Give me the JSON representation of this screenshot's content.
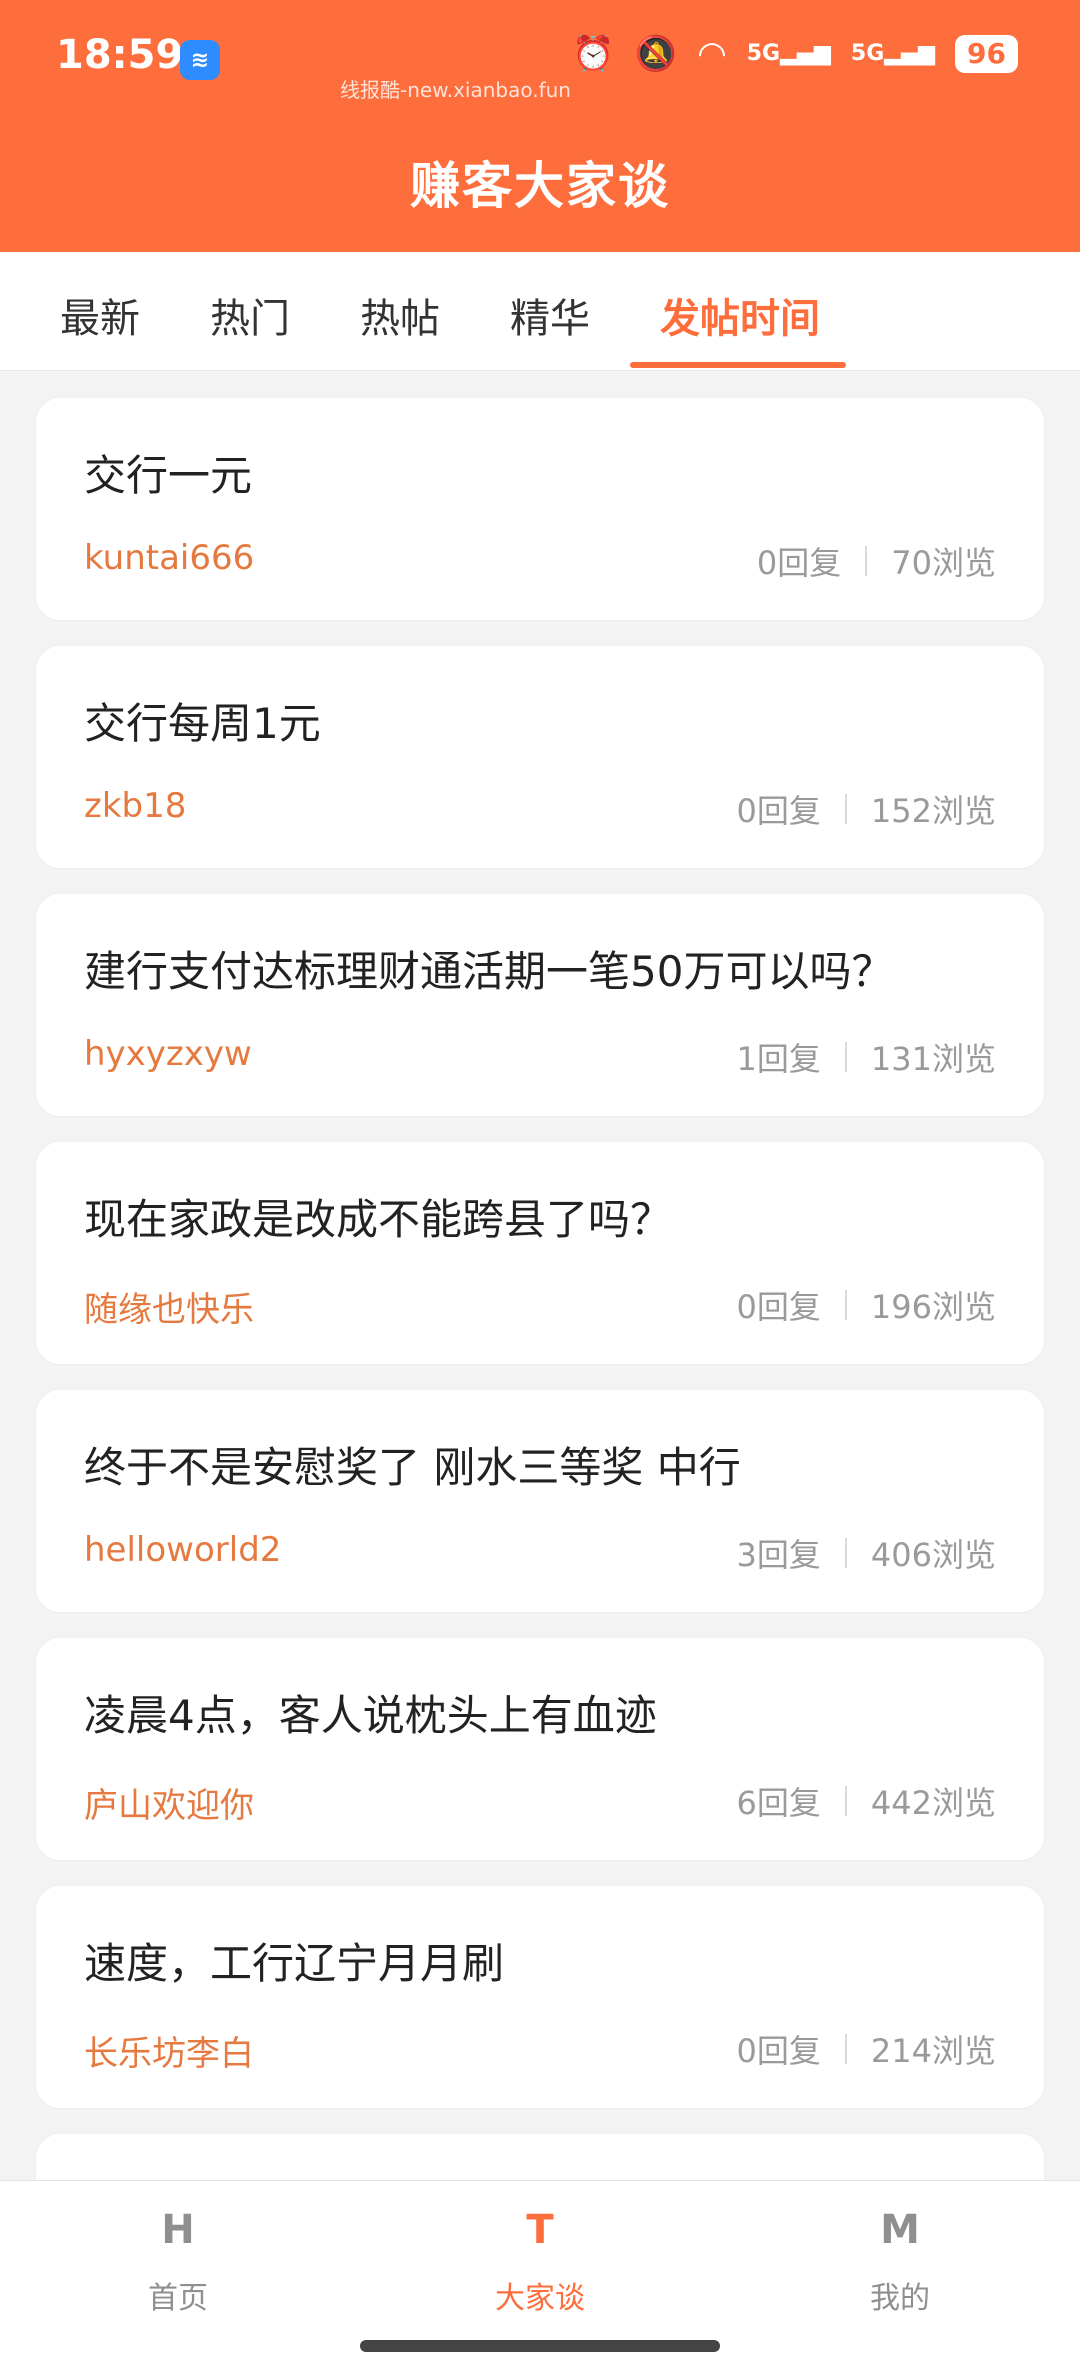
{
  "status": {
    "time": "18:59",
    "watermark": "线报酷-new.xianbao.fun",
    "signal1": "5G",
    "signal2": "5G",
    "battery": "96"
  },
  "header": {
    "title": "赚客大家谈"
  },
  "tabs": [
    {
      "label": "最新"
    },
    {
      "label": "热门"
    },
    {
      "label": "热帖"
    },
    {
      "label": "精华"
    },
    {
      "label": "发帖时间"
    }
  ],
  "posts": [
    {
      "title": "交行一元",
      "author": "kuntai666",
      "replies": "0回复",
      "views": "70浏览"
    },
    {
      "title": "交行每周1元",
      "author": "zkb18",
      "replies": "0回复",
      "views": "152浏览"
    },
    {
      "title": "建行支付达标理财通活期一笔50万可以吗？",
      "author": "hyxyzxyw",
      "replies": "1回复",
      "views": "131浏览"
    },
    {
      "title": "现在家政是改成不能跨县了吗？",
      "author": "随缘也快乐",
      "replies": "0回复",
      "views": "196浏览"
    },
    {
      "title": "终于不是安慰奖了 刚水三等奖 中行",
      "author": "helloworld2",
      "replies": "3回复",
      "views": "406浏览"
    },
    {
      "title": "凌晨4点，客人说枕头上有血迹",
      "author": "庐山欢迎你",
      "replies": "6回复",
      "views": "442浏览"
    },
    {
      "title": "速度，工行辽宁月月刷",
      "author": "长乐坊李白",
      "replies": "0回复",
      "views": "214浏览"
    }
  ],
  "bottom_nav": [
    {
      "icon": "H",
      "label": "首页"
    },
    {
      "icon": "T",
      "label": "大家谈"
    },
    {
      "icon": "M",
      "label": "我的"
    }
  ]
}
